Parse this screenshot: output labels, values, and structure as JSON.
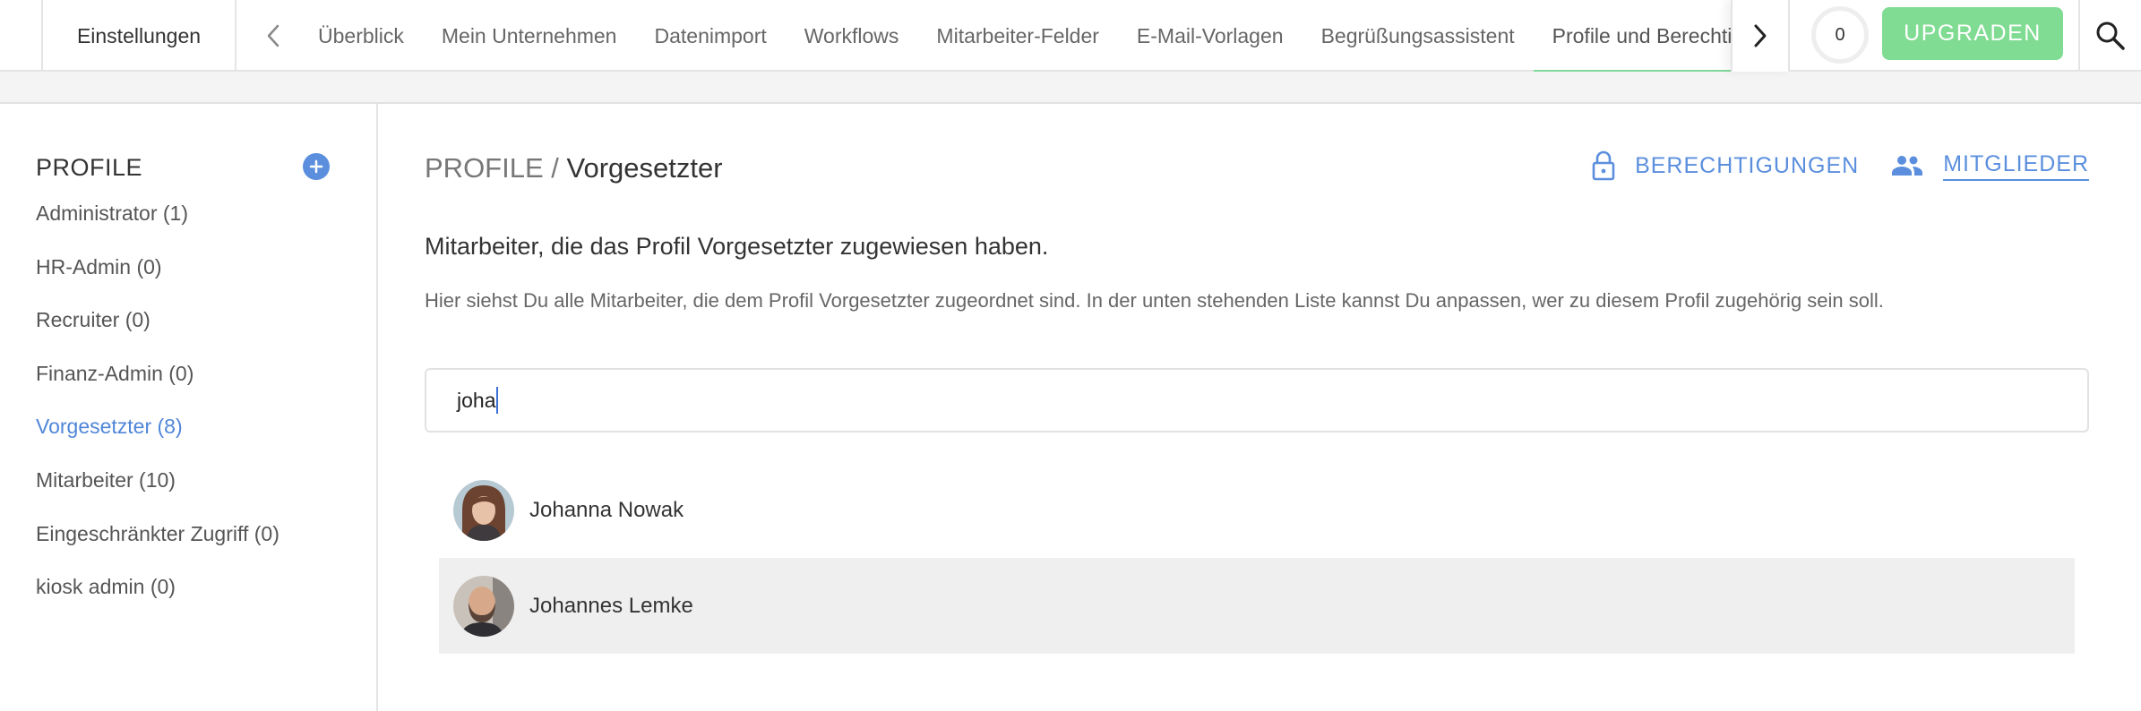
{
  "topbar": {
    "settings_label": "Einstellungen",
    "tabs": [
      {
        "label": "Überblick"
      },
      {
        "label": "Mein Unternehmen"
      },
      {
        "label": "Datenimport"
      },
      {
        "label": "Workflows"
      },
      {
        "label": "Mitarbeiter-Felder"
      },
      {
        "label": "E-Mail-Vorlagen"
      },
      {
        "label": "Begrüßungsassistent"
      },
      {
        "label": "Profile und Berechtigungen",
        "active": true
      }
    ],
    "counter": "0",
    "upgrade_label": "UPGRADEN"
  },
  "sidebar": {
    "title": "PROFILE",
    "items": [
      {
        "label": "Administrator (1)"
      },
      {
        "label": "HR-Admin (0)"
      },
      {
        "label": "Recruiter (0)"
      },
      {
        "label": "Finanz-Admin (0)"
      },
      {
        "label": "Vorgesetzter (8)",
        "active": true
      },
      {
        "label": "Mitarbeiter (10)"
      },
      {
        "label": "Eingeschränkter Zugriff (0)"
      },
      {
        "label": "kiosk admin (0)"
      }
    ]
  },
  "main": {
    "breadcrumb_root": "PROFILE /",
    "breadcrumb_current": "Vorgesetzter",
    "permissions_label": "BERECHTIGUNGEN",
    "members_label": "MITGLIEDER",
    "heading": "Mitarbeiter, die das Profil Vorgesetzter zugewiesen haben.",
    "description": "Hier siehst Du alle Mitarbeiter, die dem Profil Vorgesetzter zugeordnet sind. In der unten stehenden Liste kannst Du anpassen, wer zu diesem Profil zugehörig sein soll.",
    "search_value": "joha",
    "results": [
      {
        "name": "Johanna Nowak"
      },
      {
        "name": "Johannes Lemke"
      }
    ]
  },
  "colors": {
    "accent": "#5b8fde",
    "upgrade": "#80dc92",
    "active_tab_underline": "#7ed99a"
  }
}
